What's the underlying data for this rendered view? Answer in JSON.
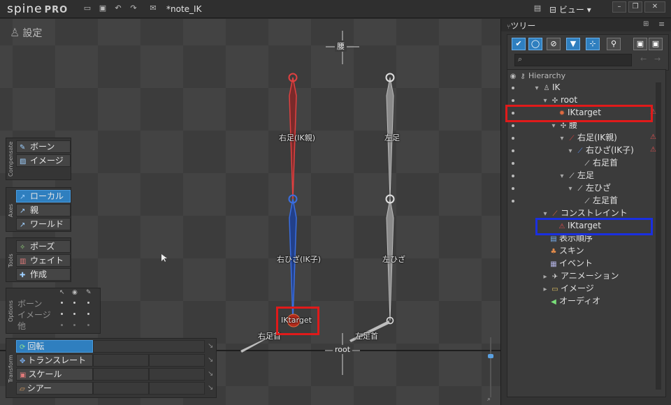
{
  "titlebar": {
    "logo_text": "spine",
    "logo_pro": "PRO",
    "doc_title": "*note_IK",
    "view_menu": "ビュー",
    "icons": [
      "folder-icon",
      "save-icon",
      "undo-icon",
      "redo-icon",
      "export-icon",
      "tree-view-icon"
    ]
  },
  "viewport": {
    "mode_label": "設定",
    "bones": {
      "r_thigh": "右足(IK親)",
      "l_thigh": "左足",
      "r_knee": "右ひざ(IK子)",
      "l_knee": "左ひざ",
      "r_ankle": "右足首",
      "l_ankle": "左足首",
      "ik_target": "IKtarget",
      "hip": "腰",
      "root": "root"
    },
    "colors": {
      "ik_parent": "#e04040",
      "ik_child": "#3a6ee0",
      "bone_grey": "#bdbdbd",
      "highlight": "#e01a1a"
    }
  },
  "compensate_panel": {
    "side_label": "Compensate",
    "buttons": [
      "ボーン",
      "イメージ"
    ]
  },
  "axes_panel": {
    "side_label": "Axes",
    "buttons": [
      "ローカル",
      "親",
      "ワールド"
    ],
    "active": "ローカル"
  },
  "tools_panel": {
    "side_label": "Tools",
    "buttons": [
      "ポーズ",
      "ウェイト",
      "作成"
    ]
  },
  "options_panel": {
    "side_label": "Options",
    "rows": [
      "ボーン",
      "イメージ",
      "他"
    ]
  },
  "transform_panel": {
    "side_label": "Transform",
    "buttons": [
      "回転",
      "トランスレート",
      "スケール",
      "シアー"
    ],
    "active": "回転"
  },
  "tree": {
    "header_title": "ツリー",
    "search_placeholder": "",
    "nodes": {
      "hierarchy": "Hierarchy",
      "ik": "IK",
      "root": "root",
      "iktarget_bone": "IKtarget",
      "hip": "腰",
      "r_thigh": "右足(IK親)",
      "r_knee": "右ひざ(IK子)",
      "r_ankle": "右足首",
      "l_thigh": "左足",
      "l_knee": "左ひざ",
      "l_ankle": "左足首",
      "constraints": "コンストレイント",
      "iktarget_constraint": "IKtarget",
      "draw_order": "表示順序",
      "skins": "スキン",
      "events": "イベント",
      "animations": "アニメーション",
      "images": "イメージ",
      "audio": "オーディオ"
    },
    "highlight_colors": {
      "red": "#e01a1a",
      "blue": "#1a2fe0"
    }
  }
}
